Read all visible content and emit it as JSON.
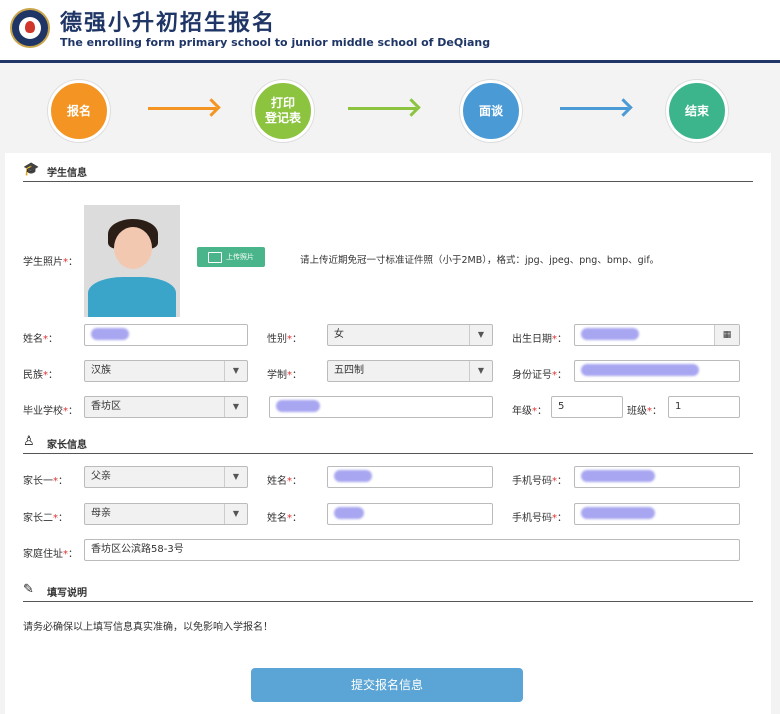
{
  "header": {
    "title_cn": "德强小升初招生报名",
    "title_en": "The enrolling form primary school to junior middle school of DeQiang"
  },
  "steps": [
    {
      "label": "报名",
      "color": "#f39423"
    },
    {
      "label": "打印\n登记表",
      "color": "#8cc440"
    },
    {
      "label": "面谈",
      "color": "#4a9ad6"
    },
    {
      "label": "结束",
      "color": "#3db58c"
    }
  ],
  "student": {
    "section_title": "学生信息",
    "photo_label": "学生照片",
    "upload_label": "上传照片",
    "photo_hint": "请上传近期免冠一寸标准证件照（小于2MB），格式：jpg、jpeg、png、bmp、gif。",
    "name_label": "姓名",
    "gender_label": "性别",
    "gender_value": "女",
    "birth_label": "出生日期",
    "ethnicity_label": "民族",
    "ethnicity_value": "汉族",
    "system_label": "学制",
    "system_value": "五四制",
    "id_label": "身份证号",
    "school_label": "毕业学校",
    "school_district": "香坊区",
    "grade_label": "年级",
    "grade_value": "5",
    "class_label": "班级",
    "class_value": "1"
  },
  "parent": {
    "section_title": "家长信息",
    "p1_label": "家长一",
    "p1_value": "父亲",
    "p2_label": "家长二",
    "p2_value": "母亲",
    "name_label": "姓名",
    "phone_label": "手机号码",
    "address_label": "家庭住址",
    "address_value": "香坊区公滨路58-3号"
  },
  "notes": {
    "section_title": "填写说明",
    "text": "请务必确保以上填写信息真实准确，以免影响入学报名！"
  },
  "submit_label": "提交报名信息",
  "required_mark": "*",
  "colon": "："
}
